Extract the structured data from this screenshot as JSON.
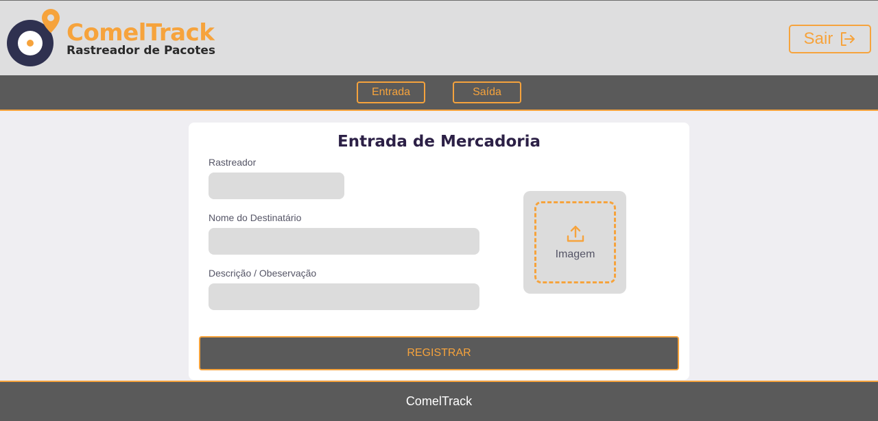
{
  "brand": {
    "name": "ComelTrack",
    "tagline": "Rastreador de Pacotes",
    "colors": {
      "accent": "#f6a33c",
      "dark_navy": "#2f3150",
      "nav_bg": "#5a5a5a",
      "header_bg": "#dededf"
    }
  },
  "header": {
    "logout_label": "Sair",
    "logout_icon": "logout-icon"
  },
  "nav": {
    "items": [
      {
        "label": "Entrada"
      },
      {
        "label": "Saída"
      }
    ]
  },
  "form": {
    "title": "Entrada de Mercadoria",
    "fields": [
      {
        "label": "Rastreador",
        "value": "",
        "placeholder": ""
      },
      {
        "label": "Nome do Destinatário",
        "value": "",
        "placeholder": ""
      },
      {
        "label": "Descrição / Obeservação",
        "value": "",
        "placeholder": ""
      }
    ],
    "upload": {
      "label": "Imagem",
      "icon": "upload-icon"
    },
    "submit_label": "REGISTRAR"
  },
  "footer": {
    "text": "ComelTrack"
  }
}
